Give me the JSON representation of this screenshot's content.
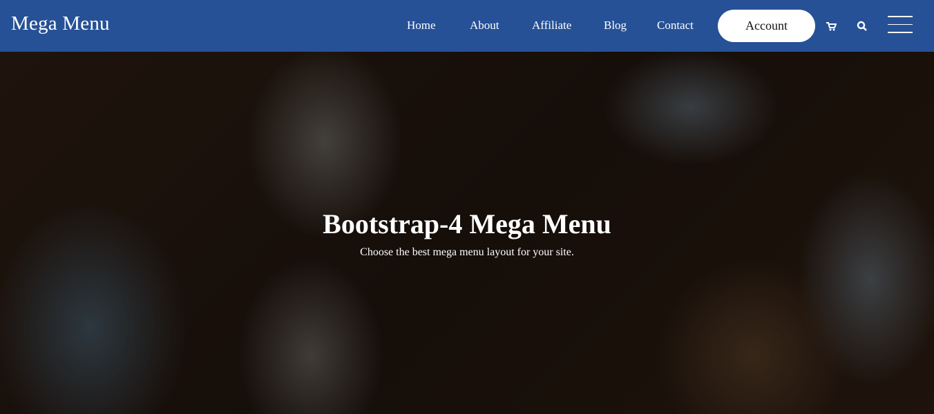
{
  "brand": "Mega Menu",
  "nav": {
    "items": [
      "Home",
      "About",
      "Affiliate",
      "Blog",
      "Contact"
    ],
    "account": "Account"
  },
  "hero": {
    "title": "Bootstrap-4 Mega Menu",
    "subtitle": "Choose the best mega menu layout for your site."
  },
  "colors": {
    "header": "#265196"
  }
}
